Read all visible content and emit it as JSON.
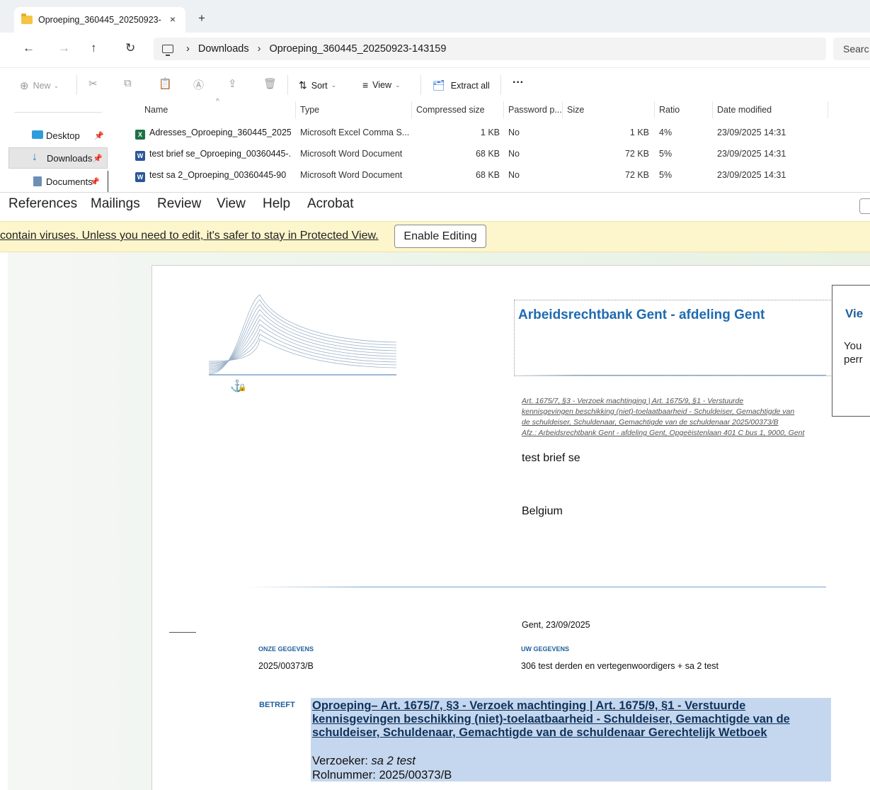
{
  "explorer": {
    "tab_title": "Oproeping_360445_20250923-",
    "tab_close": "×",
    "new_tab": "+",
    "nav": {
      "back": "←",
      "forward": "→",
      "up": "↑",
      "refresh": "↻"
    },
    "breadcrumb": {
      "sep": "›",
      "part1": "Downloads",
      "part2": "Oproeping_360445_20250923-143159"
    },
    "search_placeholder": "Searc",
    "toolbar": {
      "new_label": "New",
      "sort_label": "Sort",
      "view_label": "View",
      "extract_label": "Extract all",
      "more_label": "···"
    },
    "sidebar": [
      {
        "label": "Desktop",
        "pin": "📌"
      },
      {
        "label": "Downloads",
        "pin": "📌"
      },
      {
        "label": "Documents",
        "pin": "📌"
      }
    ],
    "columns": {
      "name": "Name",
      "type": "Type",
      "compressed": "Compressed size",
      "password": "Password p...",
      "size": "Size",
      "ratio": "Ratio",
      "date": "Date modified"
    },
    "files": [
      {
        "name": "Adresses_Oproeping_360445_2025...",
        "type": "Microsoft Excel Comma S...",
        "compressed": "1 KB",
        "password": "No",
        "size": "1 KB",
        "ratio": "4%",
        "date": "23/09/2025 14:31",
        "icon": "excel-icon"
      },
      {
        "name": "test brief se_Oproeping_00360445-...",
        "type": "Microsoft Word Document",
        "compressed": "68 KB",
        "password": "No",
        "size": "72 KB",
        "ratio": "5%",
        "date": "23/09/2025 14:31",
        "icon": "word-icon"
      },
      {
        "name": "test sa 2_Oproeping_00360445-90",
        "type": "Microsoft Word Document",
        "compressed": "68 KB",
        "password": "No",
        "size": "72 KB",
        "ratio": "5%",
        "date": "23/09/2025 14:31",
        "icon": "word-icon"
      }
    ]
  },
  "word": {
    "ribbon_tabs": [
      "References",
      "Mailings",
      "Review",
      "View",
      "Help",
      "Acrobat"
    ],
    "protected_msg": "contain viruses. Unless you need to edit, it's safer to stay in Protected View.",
    "enable_button": "Enable Editing",
    "side_panel": {
      "title": "Vie",
      "line1": "You",
      "line2": "perr"
    },
    "doc": {
      "court": "Arbeidsrechtbank Gent - afdeling Gent",
      "ref_lines": [
        "Art. 1675/7, §3 - Verzoek machtinging  | Art. 1675/9, §1 - Verstuurde",
        "kennisgevingen beschikking (niet)-toelaatbaarheid  - Schuldeiser, Gemachtigde van",
        "de schuldeiser, Schuldenaar, Gemachtigde van de schuldenaar 2025/00373/B",
        "Afz.: Arbeidsrechtbank Gent - afdeling Gent, Opgeëistenlaan 401 C bus 1, 9000, Gent"
      ],
      "recipient": "test brief se",
      "country": "Belgium",
      "place_date": "Gent, 23/09/2025",
      "onze_label": "ONZE GEGEVENS",
      "onze_value": "2025/00373/B",
      "uw_label": "UW GEGEVENS",
      "uw_value": "306 test derden en vertegenwoordigers + sa 2 test",
      "betreft_label": "BETREFT",
      "betreft_lines": [
        "Oproeping– Art. 1675/7, §3 - Verzoek machtinging  | Art. 1675/9, §1 - Verstuurde",
        "kennisgevingen beschikking (niet)-toelaatbaarheid  - Schuldeiser, Gemachtigde van de",
        "schuldeiser, Schuldenaar, Gemachtigde van de schuldenaar Gerechtelijk Wetboek"
      ],
      "verzoeker_label": "Verzoeker: ",
      "verzoeker_value": "sa 2 test",
      "rolnummer": "Rolnummer: 2025/00373/B"
    }
  }
}
